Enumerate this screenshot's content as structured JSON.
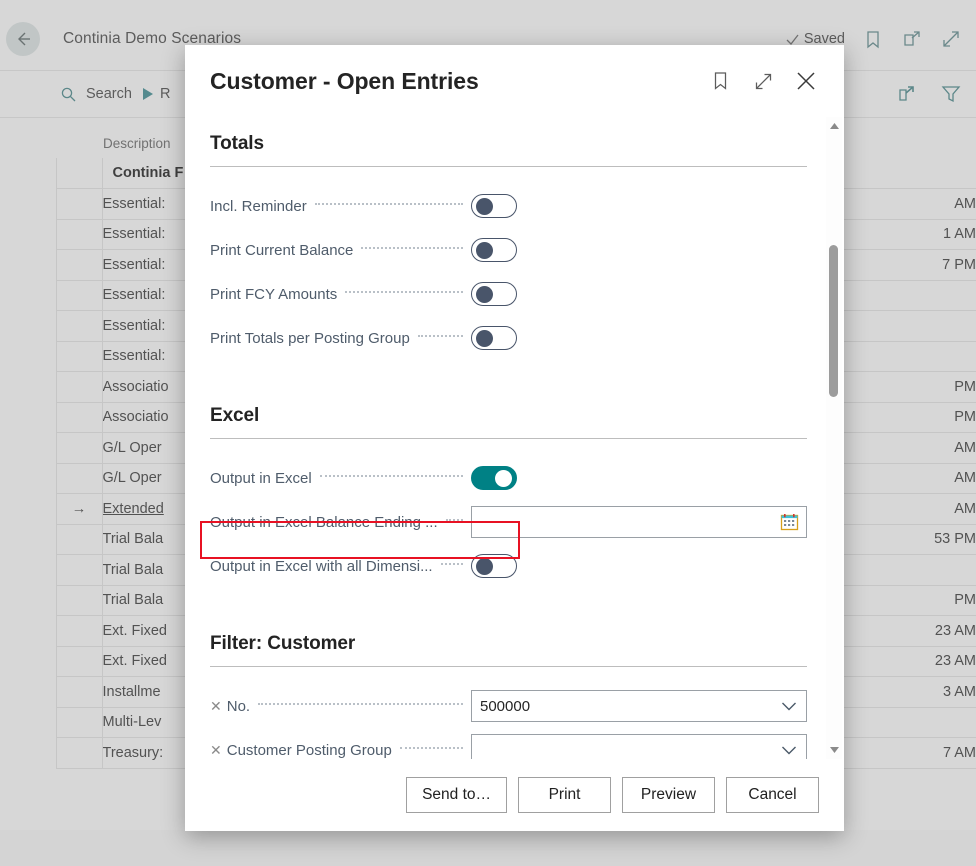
{
  "app": {
    "breadcrumb": "Continia Demo Scenarios",
    "saved_label": "Saved",
    "header_icons": [
      "bookmark-icon",
      "open-in-new-window-icon",
      "expand-icon"
    ],
    "toolbar": {
      "search_label": "Search",
      "play_label": "R",
      "share_icon": "share-icon",
      "filter_icon": "filter-icon"
    },
    "grid": {
      "columns": [
        "",
        "Description",
        ""
      ],
      "rows": [
        {
          "arrow": "",
          "description": "Continia F",
          "time": "",
          "bold": true
        },
        {
          "arrow": "",
          "description": "Essential:",
          "time": "AM"
        },
        {
          "arrow": "",
          "description": "Essential:",
          "time": "1 AM"
        },
        {
          "arrow": "",
          "description": "Essential:",
          "time": "7 PM"
        },
        {
          "arrow": "",
          "description": "Essential:",
          "time": ""
        },
        {
          "arrow": "",
          "description": "Essential:",
          "time": ""
        },
        {
          "arrow": "",
          "description": "Essential:",
          "time": ""
        },
        {
          "arrow": "",
          "description": "Associatio",
          "time": "PM"
        },
        {
          "arrow": "",
          "description": "Associatio",
          "time": "PM"
        },
        {
          "arrow": "",
          "description": "G/L Oper",
          "time": "AM"
        },
        {
          "arrow": "",
          "description": "G/L Oper",
          "time": "AM"
        },
        {
          "arrow": "→",
          "description": "Extended",
          "time": "AM",
          "selected": true
        },
        {
          "arrow": "",
          "description": "Trial Bala",
          "time": "53 PM"
        },
        {
          "arrow": "",
          "description": "Trial Bala",
          "time": ""
        },
        {
          "arrow": "",
          "description": "Trial Bala",
          "time": "PM"
        },
        {
          "arrow": "",
          "description": "Ext. Fixed",
          "time": "23 AM"
        },
        {
          "arrow": "",
          "description": "Ext. Fixed",
          "time": "23 AM"
        },
        {
          "arrow": "",
          "description": "Installme",
          "time": "3 AM"
        },
        {
          "arrow": "",
          "description": "Multi-Lev",
          "time": ""
        },
        {
          "arrow": "",
          "description": "Treasury:",
          "time": "7 AM"
        }
      ]
    }
  },
  "dialog": {
    "title": "Customer - Open Entries",
    "title_icons": [
      "bookmark-icon",
      "expand-icon",
      "close-icon"
    ],
    "sections": [
      {
        "id": "totals",
        "title": "Totals",
        "fields": [
          {
            "label": "Incl. Reminder",
            "type": "toggle",
            "value": false
          },
          {
            "label": "Print Current Balance",
            "type": "toggle",
            "value": false
          },
          {
            "label": "Print FCY Amounts",
            "type": "toggle",
            "value": false
          },
          {
            "label": "Print Totals per Posting Group",
            "type": "toggle",
            "value": false
          }
        ]
      },
      {
        "id": "excel",
        "title": "Excel",
        "fields": [
          {
            "label": "Output in Excel",
            "type": "toggle",
            "value": true,
            "highlighted": true
          },
          {
            "label": "Output in Excel Balance Ending ...",
            "type": "date",
            "value": "",
            "adorn": "calendar-icon"
          },
          {
            "label": "Output in Excel with all Dimensi...",
            "type": "toggle",
            "value": false
          }
        ]
      },
      {
        "id": "filter-customer",
        "title": "Filter: Customer",
        "fields": [
          {
            "label": "No.",
            "type": "dropdown",
            "value": "500000",
            "removable": true,
            "adorn": "chevron-down-icon"
          },
          {
            "label": "Customer Posting Group",
            "type": "dropdown",
            "value": "",
            "removable": true,
            "adorn": "chevron-down-icon"
          }
        ]
      }
    ],
    "buttons": [
      {
        "id": "send-to",
        "label": "Send to…"
      },
      {
        "id": "print",
        "label": "Print"
      },
      {
        "id": "preview",
        "label": "Preview"
      },
      {
        "id": "cancel",
        "label": "Cancel"
      }
    ]
  },
  "colors": {
    "accent_teal": "#008185",
    "toggle_off": "#49556a",
    "highlight_red": "#e81123",
    "link_teal": "#4a8a8d"
  }
}
